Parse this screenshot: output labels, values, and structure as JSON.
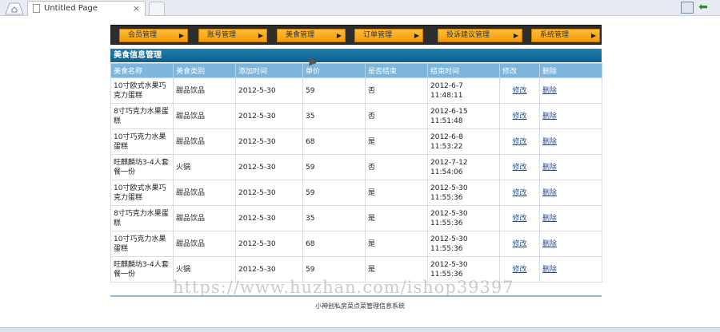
{
  "browser": {
    "tab_title": "Untitled Page",
    "tab_close": "×"
  },
  "nav": [
    {
      "label": "会员管理",
      "arrow": "▶"
    },
    {
      "label": "账号管理",
      "arrow": "▶"
    },
    {
      "label": "美食管理",
      "arrow": "▶"
    },
    {
      "label": "订单管理",
      "arrow": "▶"
    },
    {
      "label": "投诉建议管理",
      "arrow": "▶"
    },
    {
      "label": "系统管理",
      "arrow": "▶"
    }
  ],
  "panel": {
    "title": "美食信息管理"
  },
  "table": {
    "headers": [
      "美食名称",
      "美食类别",
      "添加时间",
      "单价",
      "是否结束",
      "结束时间",
      "修改",
      "删除"
    ],
    "rows": [
      [
        "10寸欧式水果巧克力蛋糕",
        "甜品饮品",
        "2012-5-30",
        "59",
        "否",
        "2012-6-7 11:48:11",
        "修改",
        "删除"
      ],
      [
        "8寸巧克力水果蛋糕",
        "甜品饮品",
        "2012-5-30",
        "35",
        "否",
        "2012-6-15 11:51:48",
        "修改",
        "删除"
      ],
      [
        "10寸巧克力水果蛋糕",
        "甜品饮品",
        "2012-5-30",
        "68",
        "是",
        "2012-6-8 11:53:22",
        "修改",
        "删除"
      ],
      [
        "旺麒麟坊3-4人套餐一份",
        "火锅",
        "2012-5-30",
        "59",
        "否",
        "2012-7-12 11:54:06",
        "修改",
        "删除"
      ],
      [
        "10寸欧式水果巧克力蛋糕",
        "甜品饮品",
        "2012-5-30",
        "59",
        "是",
        "2012-5-30 11:55:36",
        "修改",
        "删除"
      ],
      [
        "8寸巧克力水果蛋糕",
        "甜品饮品",
        "2012-5-30",
        "35",
        "是",
        "2012-5-30 11:55:36",
        "修改",
        "删除"
      ],
      [
        "10寸巧克力水果蛋糕",
        "甜品饮品",
        "2012-5-30",
        "68",
        "是",
        "2012-5-30 11:55:36",
        "修改",
        "删除"
      ],
      [
        "旺麒麟坊3-4人套餐一份",
        "火锅",
        "2012-5-30",
        "59",
        "是",
        "2012-5-30 11:55:36",
        "修改",
        "删除"
      ]
    ]
  },
  "footer": {
    "text": "小神创私房菜点菜管理信息系统"
  },
  "watermark": {
    "text": "https://www.huzhan.com/ishop39397"
  },
  "icons": {
    "back": "green-back-arrow-icon",
    "page": "page-icon",
    "home": "home-tab-icon"
  },
  "colors": {
    "nav_bar": "#2d2d2d",
    "nav_item": "#f5a516",
    "panel_header": "#156f9c",
    "table_header": "#7db6dc",
    "link": "#1d4f9c"
  }
}
